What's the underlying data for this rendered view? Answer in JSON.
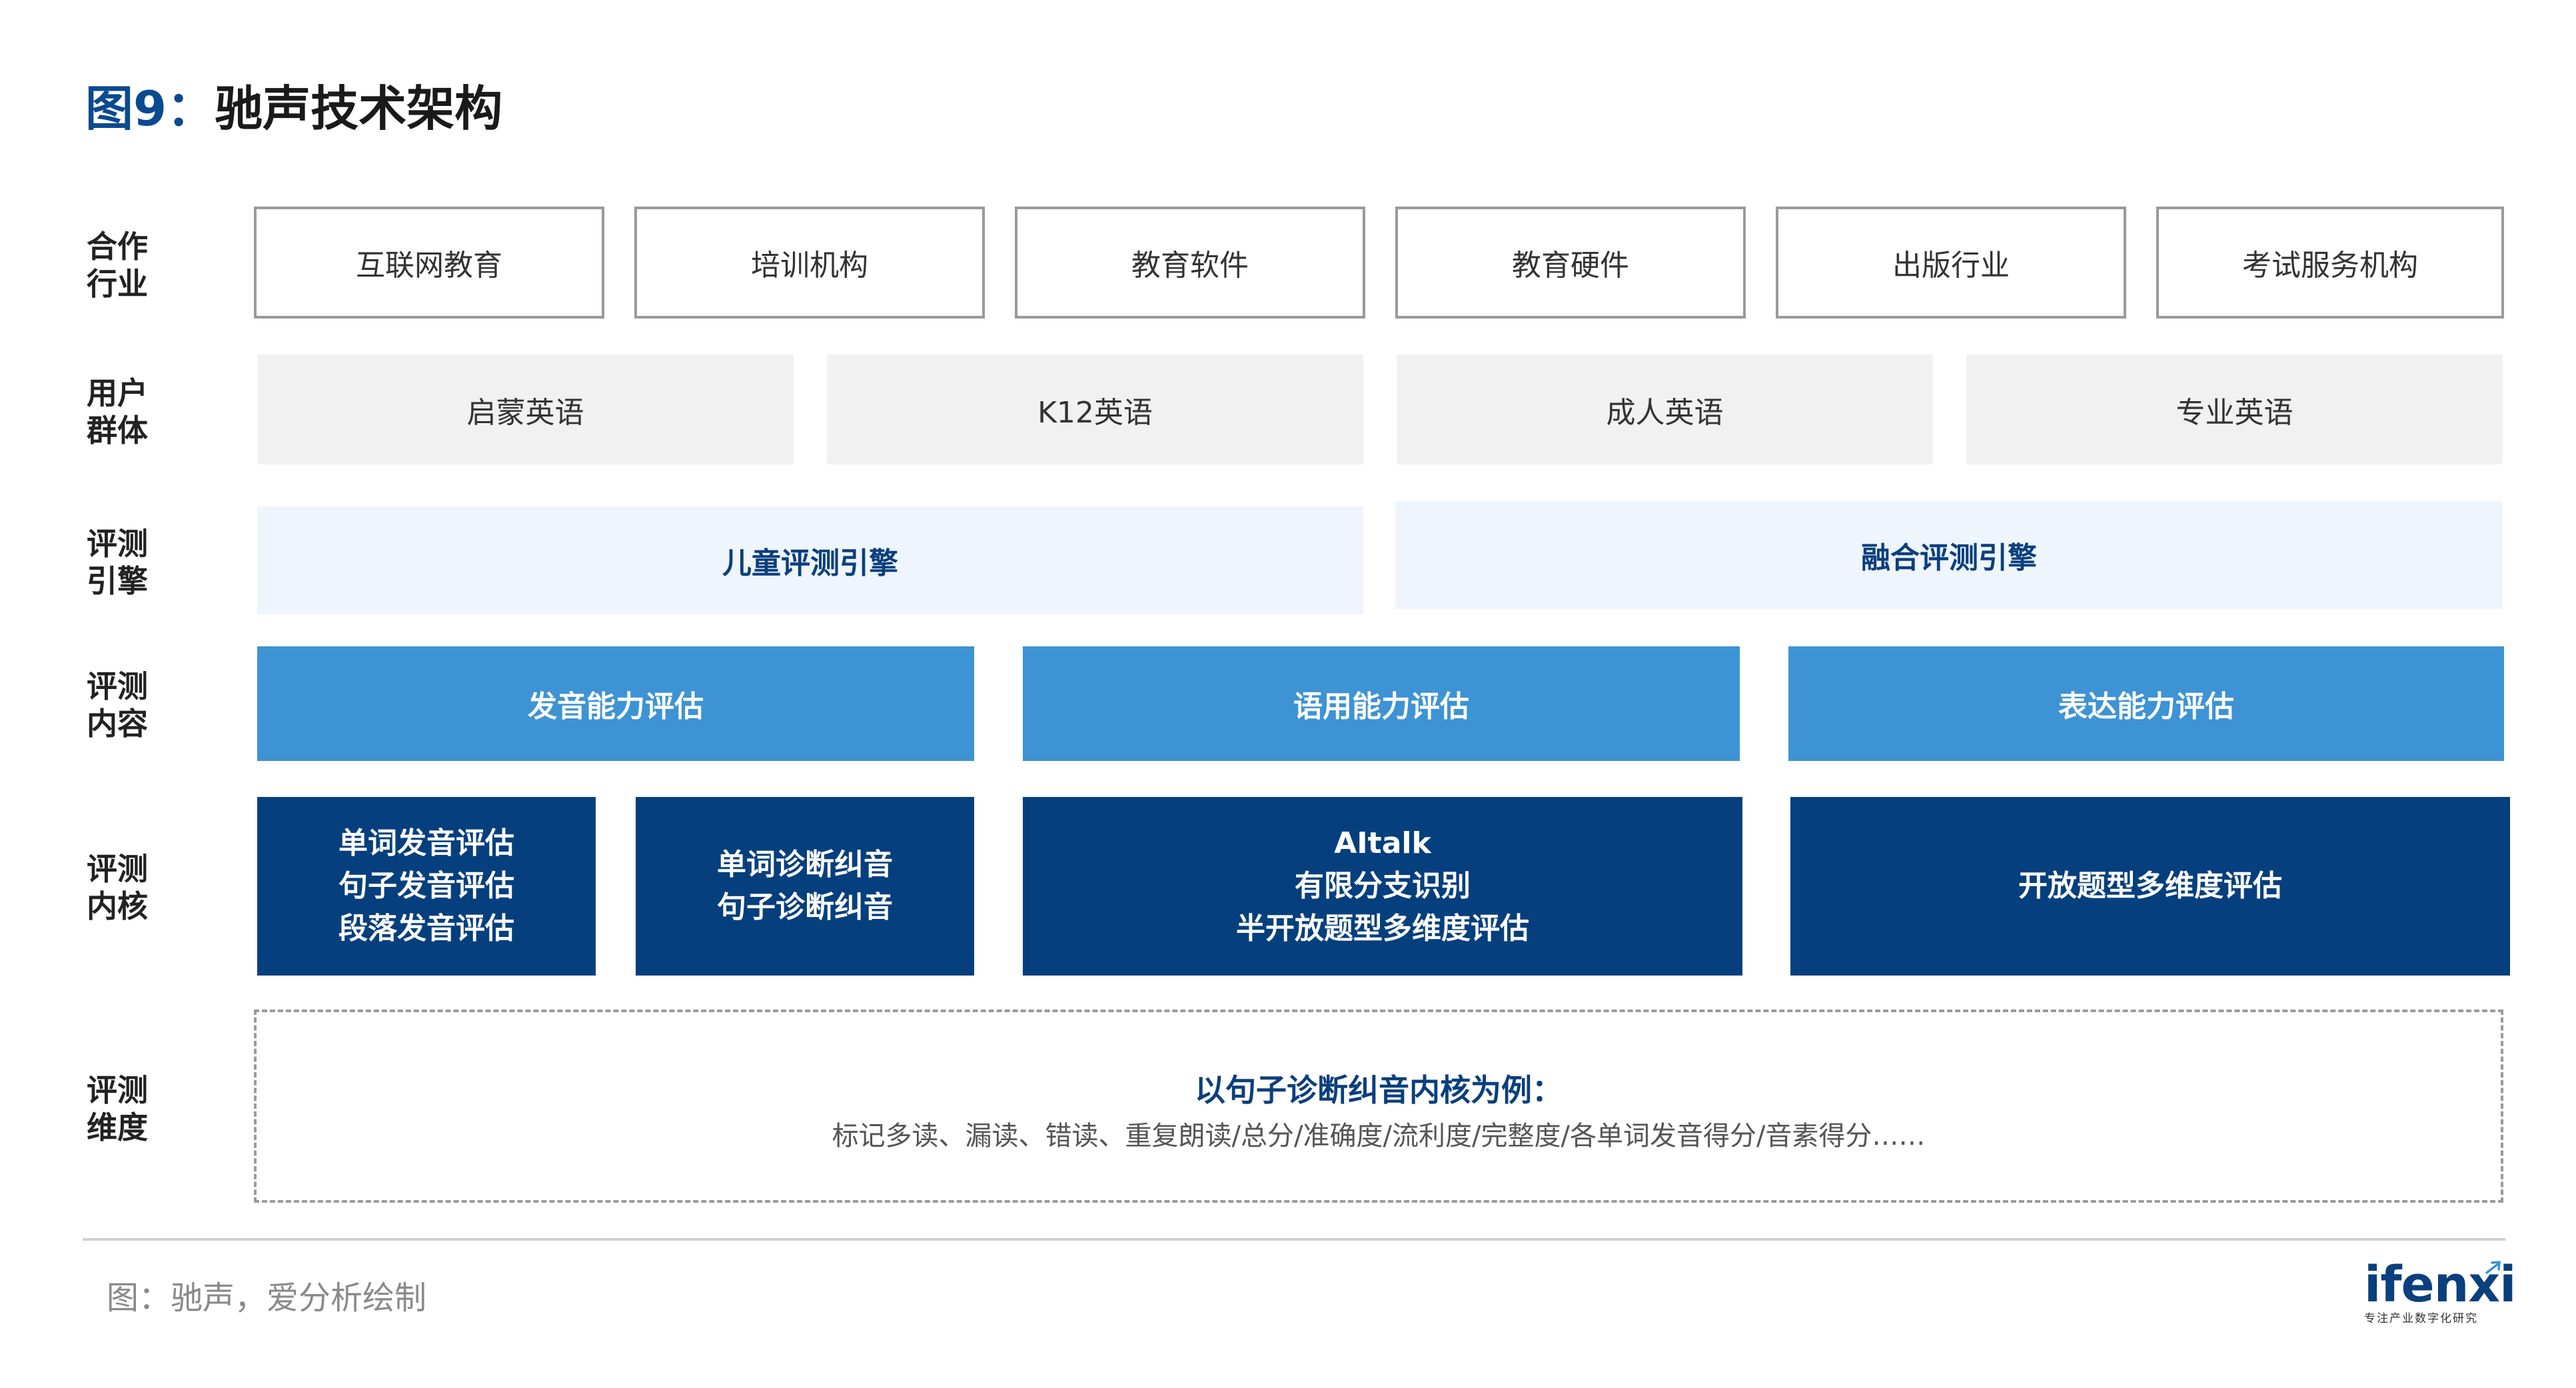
{
  "title": {
    "prefix": "图9：",
    "text": "驰声技术架构"
  },
  "rows": [
    {
      "label1": "合作",
      "label2": "行业"
    },
    {
      "label1": "用户",
      "label2": "群体"
    },
    {
      "label1": "评测",
      "label2": "引擎"
    },
    {
      "label1": "评测",
      "label2": "内容"
    },
    {
      "label1": "评测",
      "label2": "内核"
    },
    {
      "label1": "评测",
      "label2": "维度"
    }
  ],
  "industries": [
    "互联网教育",
    "培训机构",
    "教育软件",
    "教育硬件",
    "出版行业",
    "考试服务机构"
  ],
  "user_groups": [
    "启蒙英语",
    "K12英语",
    "成人英语",
    "专业英语"
  ],
  "engines": [
    "儿童评测引擎",
    "融合评测引擎"
  ],
  "contents": [
    "发音能力评估",
    "语用能力评估",
    "表达能力评估"
  ],
  "kernels": [
    {
      "lines": [
        "单词发音评估",
        "句子发音评估",
        "段落发音评估"
      ]
    },
    {
      "lines": [
        "单词诊断纠音",
        "句子诊断纠音"
      ]
    },
    {
      "lines": [
        "AItalk",
        "有限分支识别",
        "半开放题型多维度评估"
      ]
    },
    {
      "lines": [
        "开放题型多维度评估"
      ]
    }
  ],
  "dimensions": {
    "title": "以句子诊断纠音内核为例：",
    "text": "标记多读、漏读、错读、重复朗读/总分/准确度/流利度/完整度/各单词发音得分/音素得分……"
  },
  "source": "图：驰声，爱分析绘制",
  "logo": {
    "word": "ifenxi",
    "tagline": "专注产业数字化研究"
  },
  "colors": {
    "dark_blue": "#053f7d",
    "mid_blue": "#3d93d3",
    "pale_blue": "#eef5fc",
    "grey": "#f1f1f1"
  }
}
